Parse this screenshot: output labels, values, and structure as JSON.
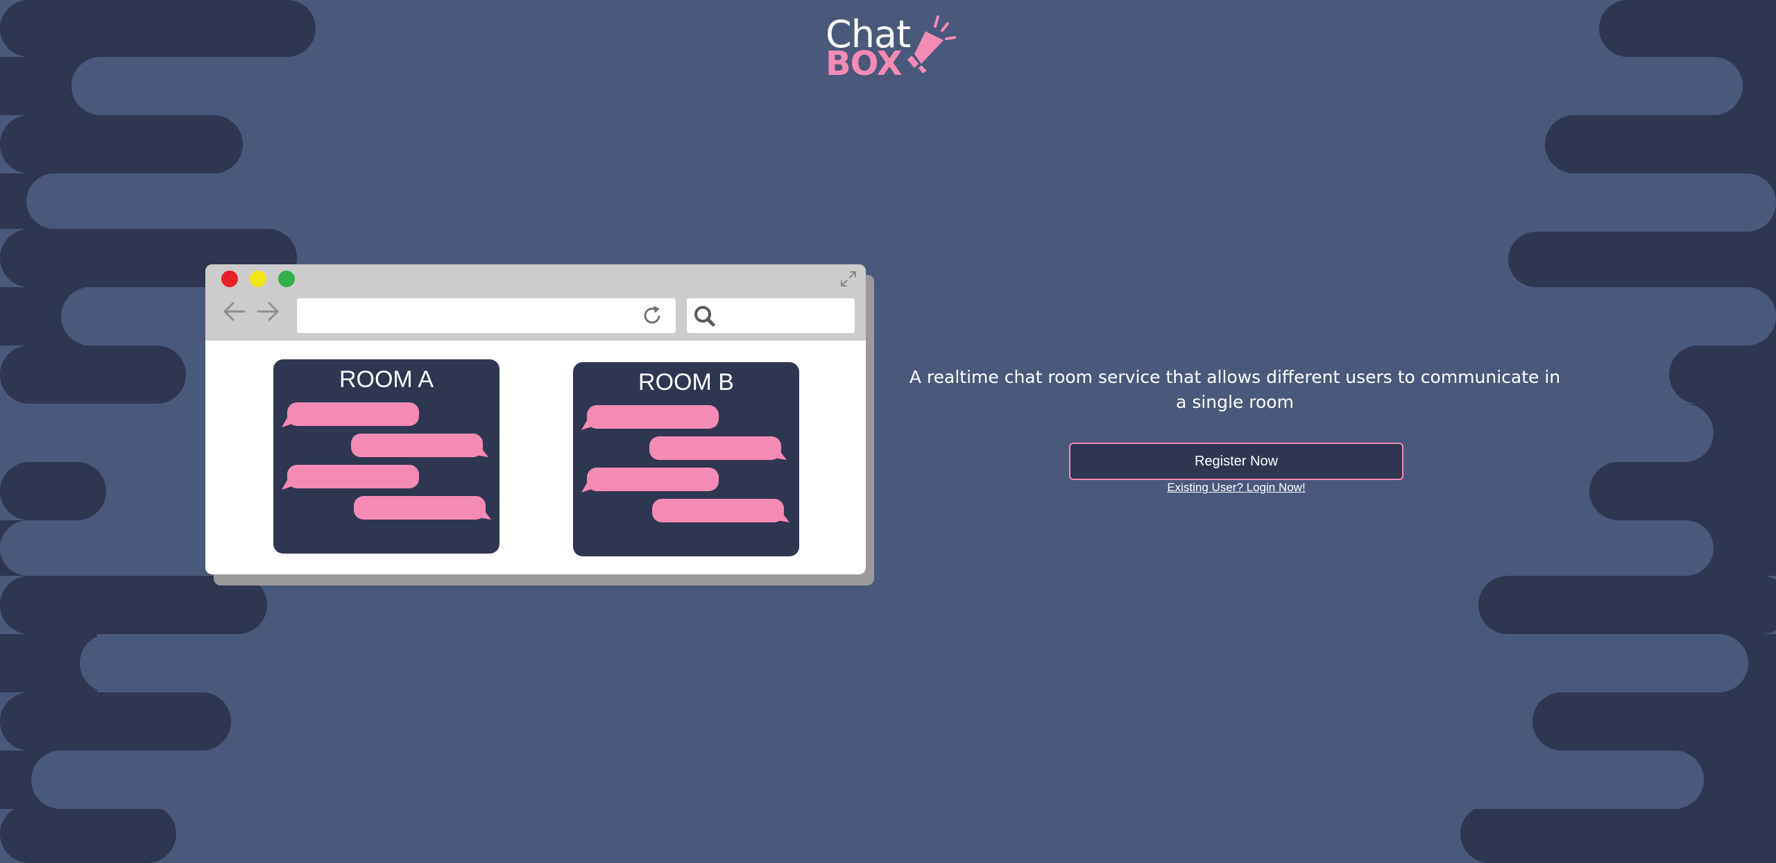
{
  "app": {
    "logo_top": "Chat",
    "logo_bottom": "BOX"
  },
  "colors": {
    "background": "#4a587a",
    "wave_dark": "#2f3650",
    "accent_pink": "#f48bb4",
    "browser_chrome": "#cccccc"
  },
  "illustration": {
    "rooms": [
      {
        "title": "ROOM A"
      },
      {
        "title": "ROOM B"
      }
    ],
    "icons": [
      "back-arrow-icon",
      "forward-arrow-icon",
      "reload-icon",
      "search-icon",
      "expand-icon"
    ]
  },
  "hero": {
    "tagline": "A realtime chat room service that allows different users to communicate in a single room",
    "register_label": "Register Now",
    "login_label": "Existing User? Login Now!"
  }
}
